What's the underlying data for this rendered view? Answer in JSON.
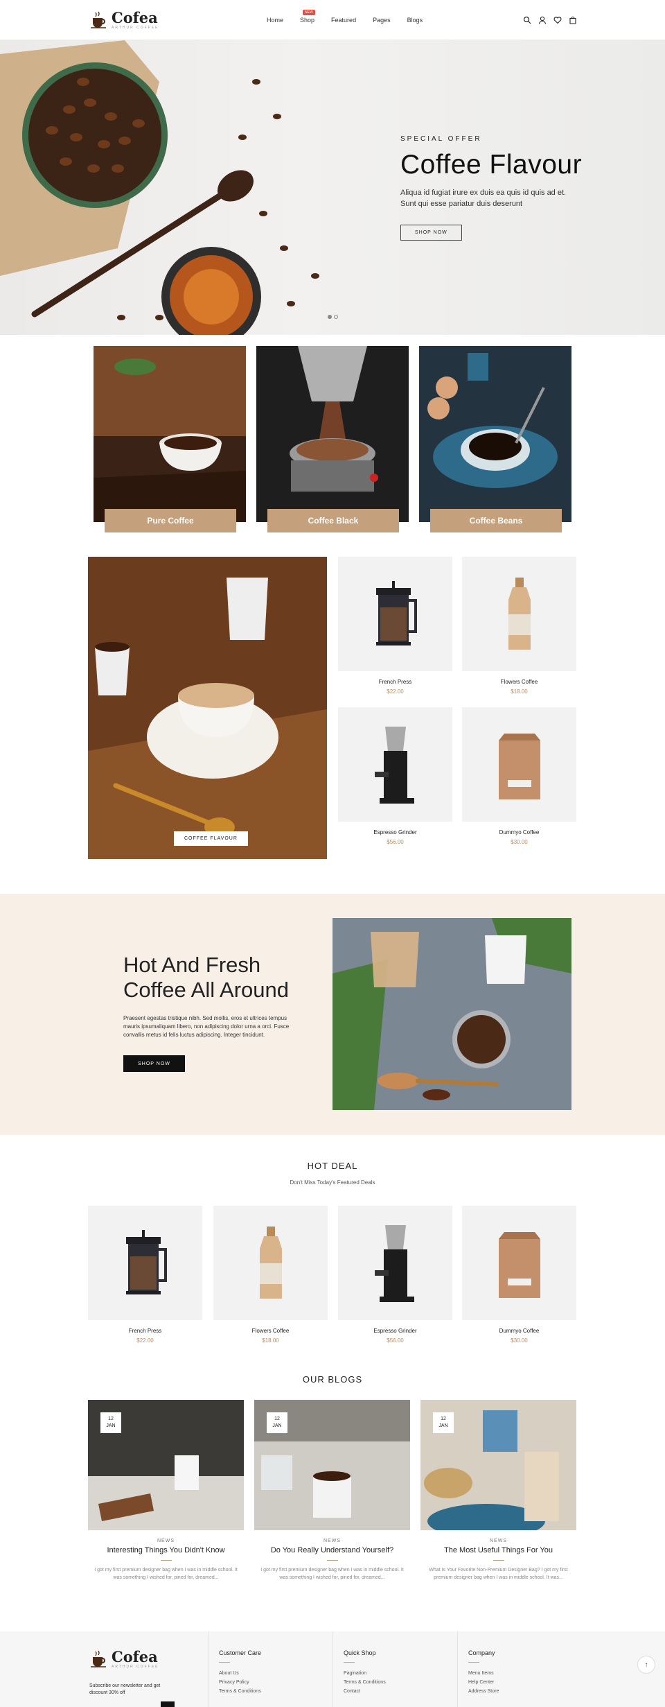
{
  "header": {
    "logo_name": "Cofea",
    "logo_tag": "ARTHUR COFFEE",
    "nav": [
      {
        "label": "Home"
      },
      {
        "label": "Shop",
        "badge": "NEW"
      },
      {
        "label": "Featured"
      },
      {
        "label": "Pages"
      },
      {
        "label": "Blogs"
      }
    ],
    "icons": [
      "search-icon",
      "user-icon",
      "heart-icon",
      "cart-icon"
    ]
  },
  "hero": {
    "eyebrow": "SPECIAL OFFER",
    "title": "Coffee Flavour",
    "text": "Aliqua id fugiat irure ex duis ea quis id quis ad et. Sunt qui esse pariatur duis deserunt",
    "button": "SHOP NOW"
  },
  "categories": [
    {
      "label": "Pure Coffee"
    },
    {
      "label": "Coffee Black"
    },
    {
      "label": "Coffee Beans"
    }
  ],
  "featured": {
    "banner_button": "COFFEE FLAVOUR",
    "products": [
      {
        "name": "French Press",
        "price": "$22.00"
      },
      {
        "name": "Flowers Coffee",
        "price": "$18.00"
      },
      {
        "name": "Espresso Grinder",
        "price": "$56.00"
      },
      {
        "name": "Dummyo Coffee",
        "price": "$30.00"
      }
    ]
  },
  "promo": {
    "title_line1": "Hot And Fresh",
    "title_line2": "Coffee All Around",
    "text": "Praesent egestas tristique nibh. Sed mollis, eros et ultrices tempus mauris ipsumaliquam libero, non adipiscing dolor urna a orci. Fusce convallis metus id felis luctus adipiscing. Integer tincidunt.",
    "button": "SHOP NOW"
  },
  "hotdeal": {
    "title": "HOT DEAL",
    "subtitle": "Don't Miss Today's Featured Deals",
    "products": [
      {
        "name": "French Press",
        "price": "$22.00"
      },
      {
        "name": "Flowers Coffee",
        "price": "$18.00"
      },
      {
        "name": "Espresso Grinder",
        "price": "$56.00"
      },
      {
        "name": "Dummyo Coffee",
        "price": "$30.00"
      }
    ]
  },
  "blogs": {
    "title": "OUR BLOGS",
    "posts": [
      {
        "day": "12",
        "month": "JAN",
        "category": "NEWS",
        "title": "Interesting Things You Didn't Know",
        "excerpt": "I got my first premium designer bag when I was in middle school. It was something I wished for, pined for, dreamed..."
      },
      {
        "day": "12",
        "month": "JAN",
        "category": "NEWS",
        "title": "Do You Really Understand Yourself?",
        "excerpt": "I got my first premium designer bag when I was in middle school. It was something I wished for, pined for, dreamed..."
      },
      {
        "day": "12",
        "month": "JAN",
        "category": "NEWS",
        "title": "The Most Useful Things For You",
        "excerpt": "What Is Your Favorite Non-Premium Designer Bag? I got my first premium designer bag when I was in middle school. It was..."
      }
    ]
  },
  "footer": {
    "newsletter": "Subscribe our newsletter and get discount 30% off",
    "columns": [
      {
        "title": "Customer Care",
        "links": [
          "About Us",
          "Privacy Policy",
          "Terms & Conditions"
        ]
      },
      {
        "title": "Quick Shop",
        "links": [
          "Pagination",
          "Terms & Conditions",
          "Contact"
        ]
      },
      {
        "title": "Company",
        "links": [
          "Menu Items",
          "Help Center",
          "Address Store"
        ]
      }
    ],
    "to_top": "↑"
  }
}
